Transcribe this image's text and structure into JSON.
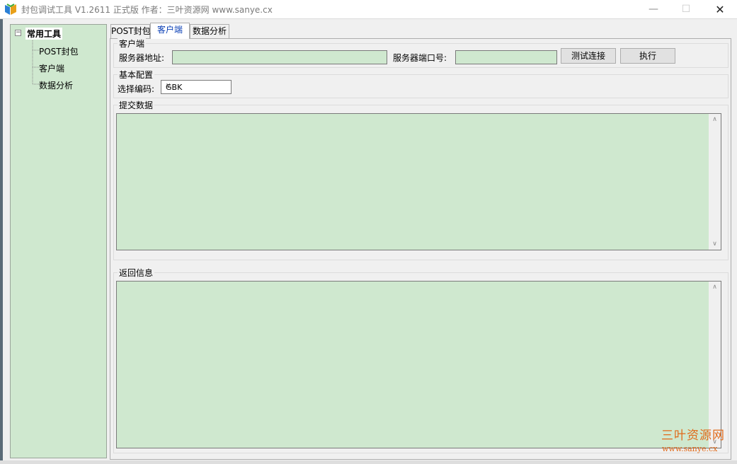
{
  "window": {
    "title": "封包调试工具 V1.2611   正式版   作者：三叶资源网     www.sanye.cx",
    "min_glyph": "—",
    "max_glyph": "☐",
    "close_glyph": "✕"
  },
  "tree": {
    "root_toggle": "−",
    "root_label": "常用工具",
    "children": [
      "POST封包",
      "客户端",
      "数据分析"
    ]
  },
  "tabs": [
    "POST封包",
    "客户端",
    "数据分析"
  ],
  "active_tab": "客户端",
  "client_group": {
    "title": "客户端",
    "server_address_label": "服务器地址:",
    "server_address_value": "",
    "server_port_label": "服务器端口号:",
    "server_port_value": "",
    "test_button": "测试连接",
    "execute_button": "执行"
  },
  "config_group": {
    "title": "基本配置",
    "encoding_label": "选择编码:",
    "encoding_value": "GBK"
  },
  "submit_group": {
    "title": "提交数据",
    "value": ""
  },
  "response_group": {
    "title": "返回信息",
    "value": ""
  },
  "watermark": {
    "name": "三叶资源网",
    "url": "www.sanye.cx"
  },
  "colors": {
    "field_bg": "#cfe8cf",
    "active_tab_text": "#0a3fb5",
    "watermark": "#e06a1a"
  }
}
